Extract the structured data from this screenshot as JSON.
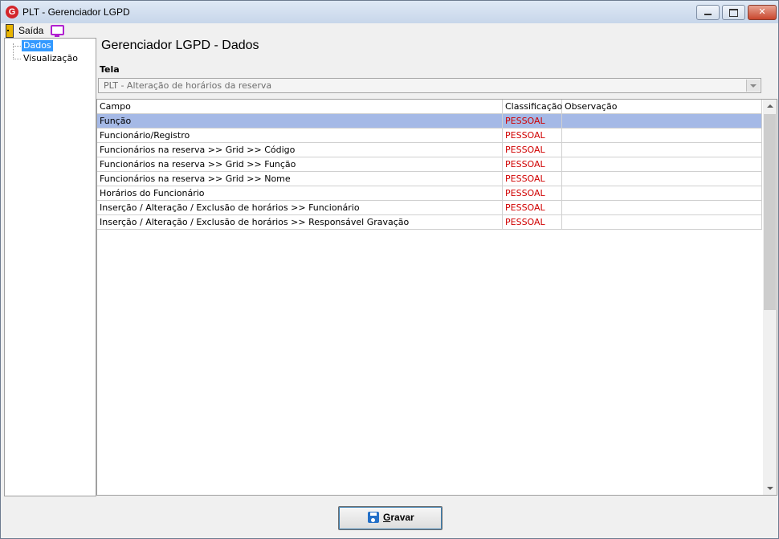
{
  "window": {
    "title": "PLT - Gerenciador LGPD"
  },
  "menu": {
    "saida_label": "Saída"
  },
  "tree": {
    "items": [
      {
        "label": "Dados"
      },
      {
        "label": "Visualização"
      }
    ]
  },
  "main": {
    "title": "Gerenciador LGPD - Dados",
    "tela_label": "Tela",
    "tela_value": "PLT - Alteração de horários da reserva"
  },
  "grid": {
    "columns": [
      "Campo",
      "Classificação",
      "Observação"
    ],
    "rows": [
      {
        "campo": "Função",
        "classificacao": "PESSOAL",
        "observacao": ""
      },
      {
        "campo": "Funcionário/Registro",
        "classificacao": "PESSOAL",
        "observacao": ""
      },
      {
        "campo": "Funcionários na reserva >> Grid >> Código",
        "classificacao": "PESSOAL",
        "observacao": ""
      },
      {
        "campo": "Funcionários na reserva >> Grid >> Função",
        "classificacao": "PESSOAL",
        "observacao": ""
      },
      {
        "campo": "Funcionários na reserva >> Grid >> Nome",
        "classificacao": "PESSOAL",
        "observacao": ""
      },
      {
        "campo": "Horários do Funcionário",
        "classificacao": "PESSOAL",
        "observacao": ""
      },
      {
        "campo": "Inserção / Alteração / Exclusão de horários >> Funcionário",
        "classificacao": "PESSOAL",
        "observacao": ""
      },
      {
        "campo": "Inserção / Alteração / Exclusão de horários >> Responsável Gravação",
        "classificacao": "PESSOAL",
        "observacao": ""
      }
    ]
  },
  "footer": {
    "gravar_first": "G",
    "gravar_rest": "ravar"
  },
  "colors": {
    "selection": "#a5b9e6",
    "classification_text": "#d00000",
    "tree_selection": "#3399ff"
  }
}
